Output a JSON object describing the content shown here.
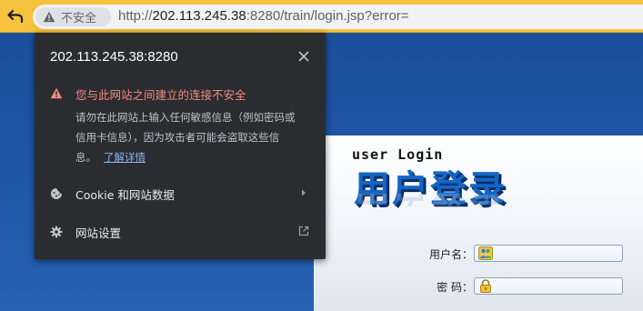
{
  "address_bar": {
    "security_chip_label": "不安全",
    "url_scheme": "http://",
    "url_host": "202.113.245.38",
    "url_rest": ":8280/train/login.jsp?error=",
    "icons": {
      "back": "back-arrow-icon",
      "warning": "warning-triangle-icon"
    }
  },
  "site_info_popup": {
    "host": "202.113.245.38:8280",
    "warning_title": "您与此网站之间建立的连接不安全",
    "warning_body_lines": [
      "请勿在此网站上输入任何敏感信息（例如密码或",
      "信用卡信息），因为攻击者可能会盗取这些信",
      "息。"
    ],
    "learn_more_link": "了解详情",
    "cookie_row_label": "Cookie 和网站数据",
    "site_settings_row_label": "网站设置",
    "colors": {
      "warning": "#f28b82",
      "link": "#8ab4f8",
      "background": "#2b2c2f"
    }
  },
  "login": {
    "subtitle": "user Login",
    "title": "用户登录",
    "username_label": "用户名：",
    "password_label": "密 码：",
    "username_value": "",
    "password_value": ""
  },
  "colors": {
    "toolbar": "#f6c23e",
    "page_background": "#1f56a6",
    "logo_blue": "#1466c6"
  }
}
